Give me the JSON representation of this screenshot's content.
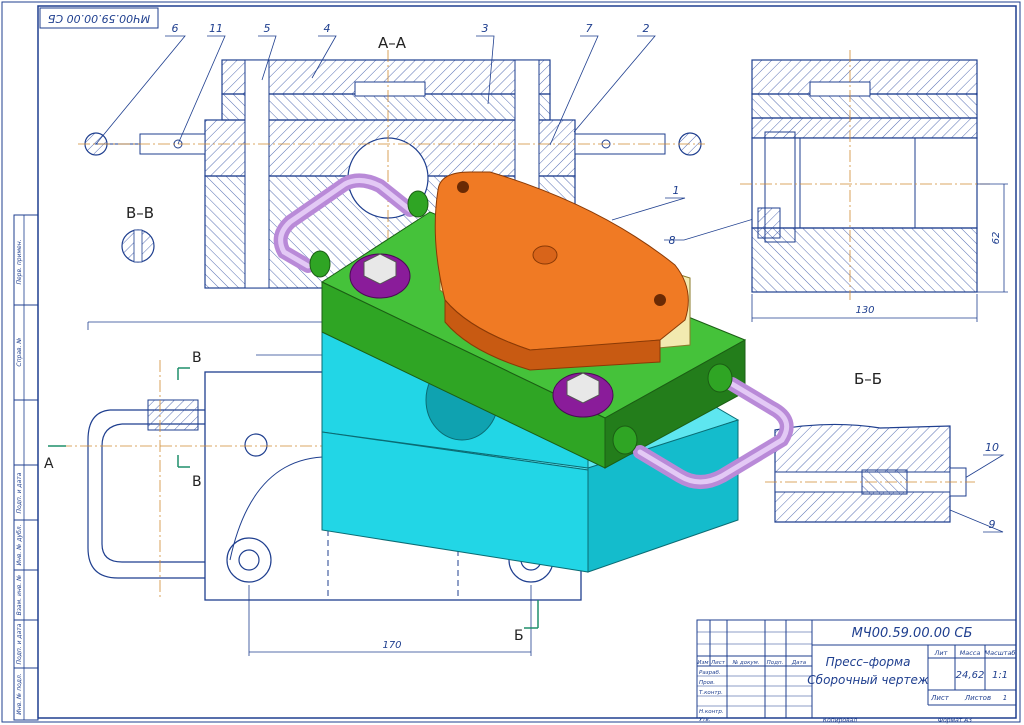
{
  "stamp_code_rotated": "МЧ00.59.00.00 СБ",
  "callouts": [
    "6",
    "11",
    "5",
    "4",
    "3",
    "7",
    "2",
    "1",
    "8",
    "10",
    "9"
  ],
  "sections": {
    "aa": "А–А",
    "vv": "В–В",
    "bb": "Б–Б",
    "a_mark": "А",
    "v_mark_top": "В",
    "v_mark_bottom": "В",
    "b_mark": "Б"
  },
  "dimensions": {
    "length": "170",
    "width": "130",
    "height": "62"
  },
  "title_block": {
    "code": "МЧ00.59.00.00 СБ",
    "name_line1": "Пресс–форма",
    "name_line2": "Сборочный чертеж",
    "col_lit": "Лит",
    "col_mass": "Масса",
    "col_scale": "Масштаб",
    "mass": "24,62",
    "scale": "1:1",
    "sheet_label": "Лист",
    "sheets_label": "Листов",
    "sheets": "1",
    "rev_headers": [
      "Изм",
      "Лист",
      "№ докум.",
      "Подп.",
      "Дата"
    ],
    "roles": [
      "Разраб.",
      "Пров.",
      "Т.контр.",
      "",
      "Н.контр.",
      "Утв."
    ],
    "copied": "Копировал",
    "format": "Формат  А3"
  },
  "side_strip": [
    "Перв. примен.",
    "Справ. №",
    "Подп. и дата",
    "Инв. № дубл.",
    "Взам. инв. №",
    "Подп. и дата",
    "Инв. № подл."
  ],
  "colors": {
    "frame": "#1f3f8f",
    "top_plate": "#f07a24",
    "insert": "#f2eab0",
    "middle_plate": "#2fa524",
    "base": "#22d6e6",
    "handle": "#c9a0e8",
    "washer": "#8a1c9a"
  }
}
